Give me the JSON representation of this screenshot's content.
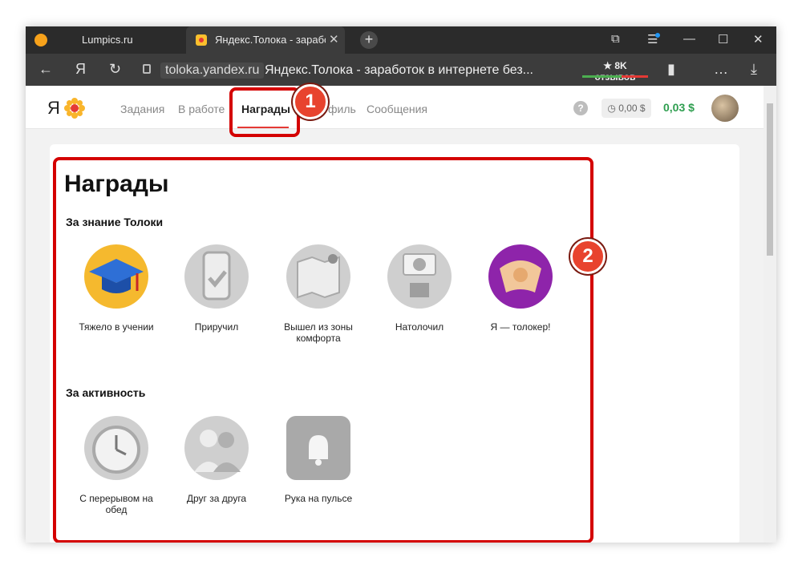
{
  "browser": {
    "tabs": [
      {
        "label": "Lumpics.ru"
      },
      {
        "label": "Яндекс.Толока - зарабо"
      }
    ],
    "domain": "toloka.yandex.ru",
    "page_title": "Яндекс.Толока - заработок в интернете без...",
    "reviews": "★ 8K отзывов",
    "ya_button": "Я"
  },
  "header": {
    "logo": "Я",
    "nav": [
      "Задания",
      "В работе",
      "Награды",
      "филь",
      "Сообщения"
    ],
    "help": "?",
    "balance_pending": "◷ 0,00 $",
    "balance": "0,03 $"
  },
  "main": {
    "title": "Награды",
    "sections": [
      {
        "title": "За знание Толоки",
        "badges": [
          "Тяжело в учении",
          "Приручил",
          "Вышел из зоны комфорта",
          "Натолочил",
          "Я — толокер!"
        ]
      },
      {
        "title": "За активность",
        "badges": [
          "С перерывом на обед",
          "Друг за друга",
          "Рука на пульсе"
        ]
      }
    ]
  },
  "callouts": [
    "1",
    "2"
  ],
  "colors": {
    "accent_red": "#d40000",
    "balance_green": "#2e9e4f",
    "chrome_dark": "#2b2b2b"
  }
}
